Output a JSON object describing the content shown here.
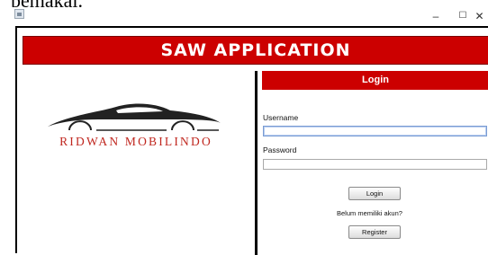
{
  "top_caption": "pemakai.",
  "window": {
    "controls": {
      "minimize": "–",
      "maximize": "☐",
      "close": "✕"
    }
  },
  "header": {
    "title": "SAW APPLICATION"
  },
  "brand": {
    "name": "RIDWAN MOBILINDO",
    "color": "#c0271f"
  },
  "login": {
    "title": "Login",
    "username_label": "Username",
    "username_value": "",
    "password_label": "Password",
    "password_value": "",
    "login_button": "Login",
    "prompt": "Belum memiliki akun?",
    "register_button": "Register"
  },
  "colors": {
    "accent": "#cc0000"
  }
}
